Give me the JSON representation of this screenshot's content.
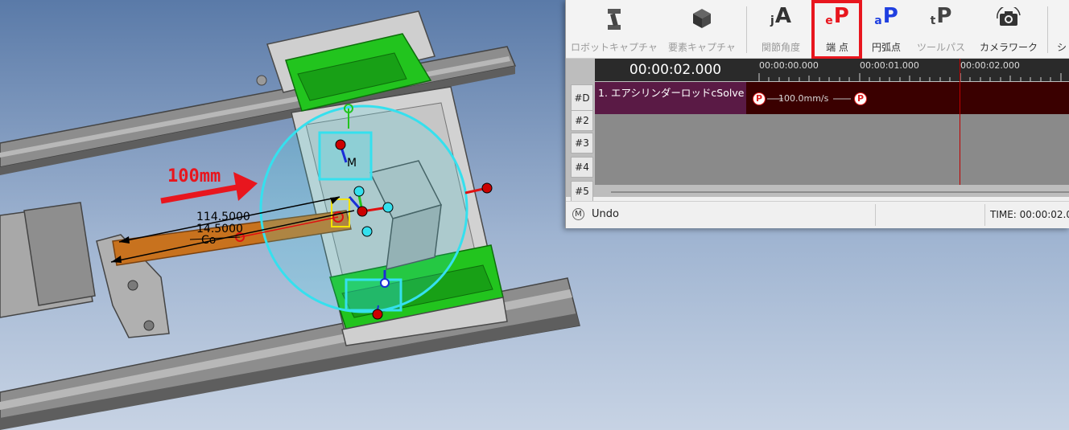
{
  "viewport": {
    "annotation_label": "100mm",
    "dimension_1": "114.5000",
    "dimension_2": "14.5000",
    "origin_label": "Co",
    "model_label": "M",
    "colors": {
      "annotation": "#e8161e",
      "gizmo": "#35e0ee",
      "rod": "#c8721e",
      "slider": "#22c41e"
    }
  },
  "toolbar": {
    "buttons": [
      {
        "label": "ロボットキャプチャ",
        "icon": "robot-arm-icon",
        "enabled": false
      },
      {
        "label": "要素キャプチャ",
        "icon": "cube-icon",
        "enabled": false
      },
      {
        "label": "関節角度",
        "icon": "joint-angle-icon",
        "glyph": "A",
        "prefix": "j",
        "enabled": false
      },
      {
        "label": "端 点",
        "icon": "end-point-icon",
        "glyph": "P",
        "prefix": "e",
        "enabled": true
      },
      {
        "label": "円弧点",
        "icon": "arc-point-icon",
        "glyph": "P",
        "prefix": "a",
        "enabled": true
      },
      {
        "label": "ツールパス",
        "icon": "tool-path-icon",
        "glyph": "P",
        "prefix": "t",
        "enabled": false
      },
      {
        "label": "カメラワーク",
        "icon": "camera-icon",
        "enabled": true
      },
      {
        "label": "シ",
        "icon": "",
        "enabled": true
      }
    ],
    "highlight_color": "#e8161e"
  },
  "timeline": {
    "current_time": "00:00:02.000",
    "ruler": [
      "00:00:00.000",
      "00:00:01.000",
      "00:00:02.000"
    ],
    "tracks": [
      "#D",
      "#2",
      "#3",
      "#4",
      "#5"
    ],
    "track1_label": "1. エアシリンダーロッドcSolve",
    "speed": "100.0mm/s",
    "point_marker": "P"
  },
  "status": {
    "undo_key": "M",
    "undo_label": "Undo",
    "time": "TIME: 00:00:02.0"
  }
}
